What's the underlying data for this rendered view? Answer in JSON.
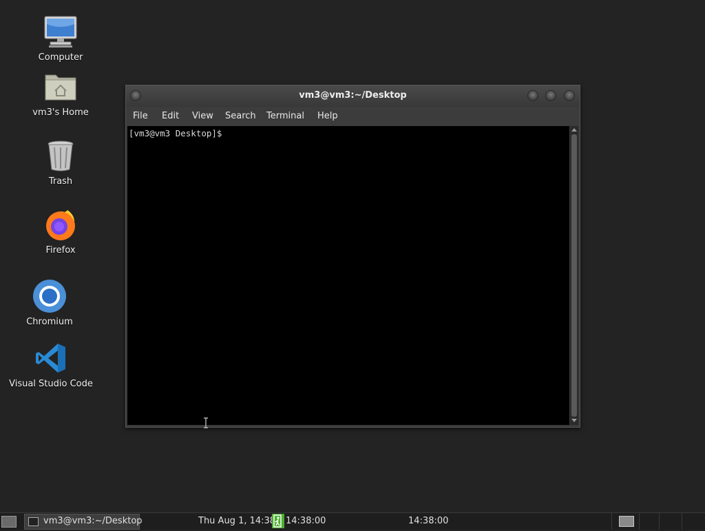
{
  "desktop": {
    "icons": [
      {
        "label": "Computer",
        "icon": "computer-icon"
      },
      {
        "label": "vm3's Home",
        "icon": "home-folder-icon"
      },
      {
        "label": "Trash",
        "icon": "trash-icon"
      },
      {
        "label": "Firefox",
        "icon": "firefox-icon"
      },
      {
        "label": "Chromium",
        "icon": "chromium-icon"
      },
      {
        "label": "Visual Studio Code",
        "icon": "vscode-icon"
      }
    ]
  },
  "terminal": {
    "title": "vm3@vm3:~/Desktop",
    "menu": [
      "File",
      "Edit",
      "View",
      "Search",
      "Terminal",
      "Help"
    ],
    "prompt": "[vm3@vm3 Desktop]$ "
  },
  "taskbar": {
    "task_label": "vm3@vm3:~/Desktop",
    "clock_left": "Thu Aug  1, 14:38",
    "clock_mid": "14:38:00",
    "clock_right": "14:38:00"
  },
  "colors": {
    "desktop_bg": "#232323",
    "terminal_bg": "#000000",
    "vscode_blue": "#2a8ad4",
    "firefox_orange": "#ff7a1a",
    "exit_green": "#4caf2f"
  }
}
